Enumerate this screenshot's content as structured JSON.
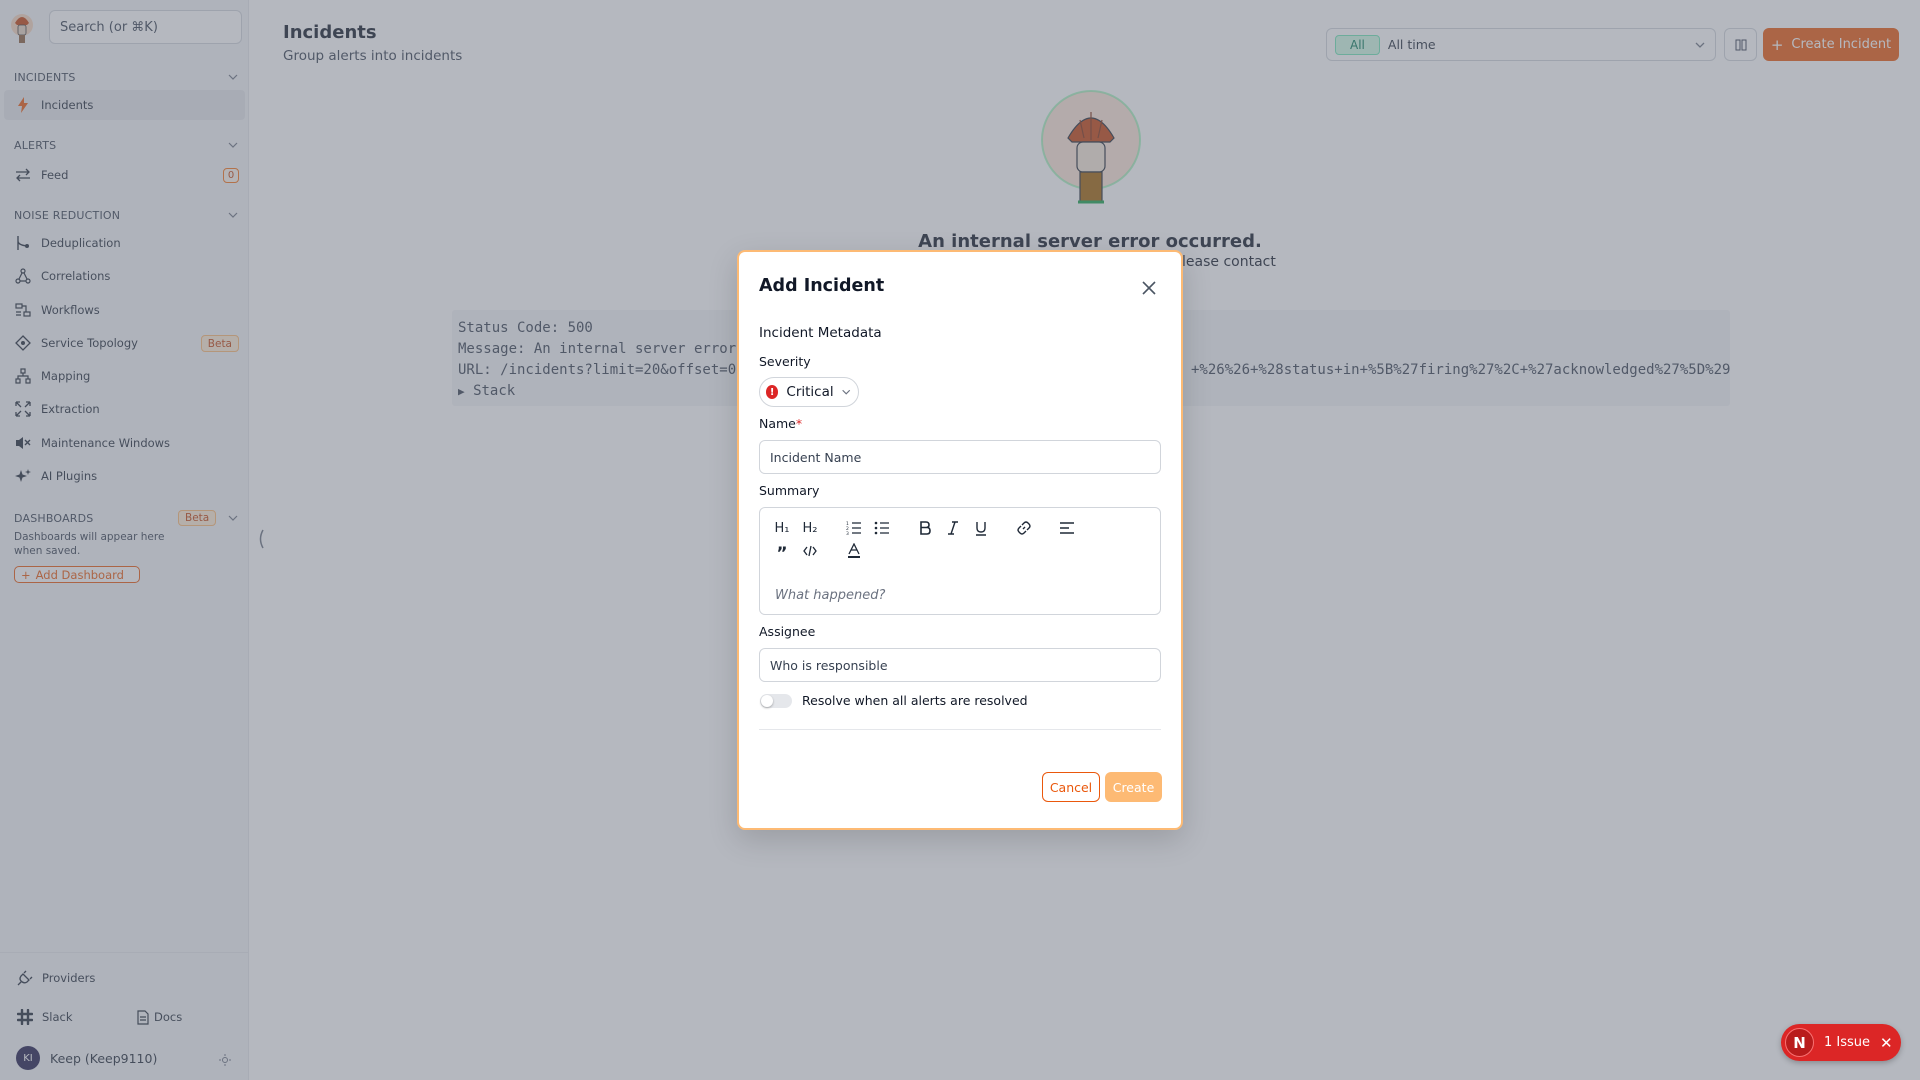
{
  "sidebar": {
    "search_placeholder": "Search (or ⌘K)",
    "sections": {
      "incidents": "INCIDENTS",
      "alerts": "ALERTS",
      "noise_reduction": "NOISE REDUCTION",
      "dashboards": "DASHBOARDS"
    },
    "items": {
      "incidents": "Incidents",
      "feed": "Feed",
      "feed_count": "0",
      "deduplication": "Deduplication",
      "correlations": "Correlations",
      "workflows": "Workflows",
      "service_topology": "Service Topology",
      "service_topology_badge": "Beta",
      "mapping": "Mapping",
      "extraction": "Extraction",
      "maintenance_windows": "Maintenance Windows",
      "ai_plugins": "AI Plugins"
    },
    "dashboards_badge": "Beta",
    "dashboards_hint": "Dashboards will appear here when saved.",
    "add_dashboard": "Add Dashboard",
    "bottom": {
      "providers": "Providers",
      "slack": "Slack",
      "docs": "Docs",
      "user_initials": "KI",
      "user_name": "Keep (Keep9110)"
    }
  },
  "header": {
    "title": "Incidents",
    "subtitle": "Group alerts into incidents",
    "filter_all": "All",
    "filter_range": "All time",
    "create_button": "Create Incident"
  },
  "error": {
    "title": "An internal server error occurred.",
    "subtitle_visible": "lease contact",
    "status_line": "Status Code: 500",
    "message_line": "Message: An internal server error",
    "url_line": "URL: /incidents?limit=20&offset=0",
    "url_tail": "+%26%26+%28status+in+%5B%27firing%27%2C+%27acknowledged%27%5D%29",
    "stack_label": "Stack"
  },
  "modal": {
    "title": "Add Incident",
    "section": "Incident Metadata",
    "severity_label": "Severity",
    "severity_value": "Critical",
    "name_label": "Name",
    "name_required": "*",
    "name_placeholder": "Incident Name",
    "summary_label": "Summary",
    "summary_placeholder": "What happened?",
    "toolbar": {
      "h1": "H₁",
      "h2": "H₂"
    },
    "assignee_label": "Assignee",
    "assignee_placeholder": "Who is responsible",
    "resolve_toggle_label": "Resolve when all alerts are resolved",
    "resolve_toggle_on": false,
    "cancel": "Cancel",
    "create": "Create"
  },
  "issue_toast": {
    "logo_letter": "N",
    "label": "1 Issue"
  },
  "colors": {
    "accent": "#ea580c",
    "accent_light": "#fdba74",
    "critical": "#dc2626",
    "filter_all_green": "#047857"
  }
}
